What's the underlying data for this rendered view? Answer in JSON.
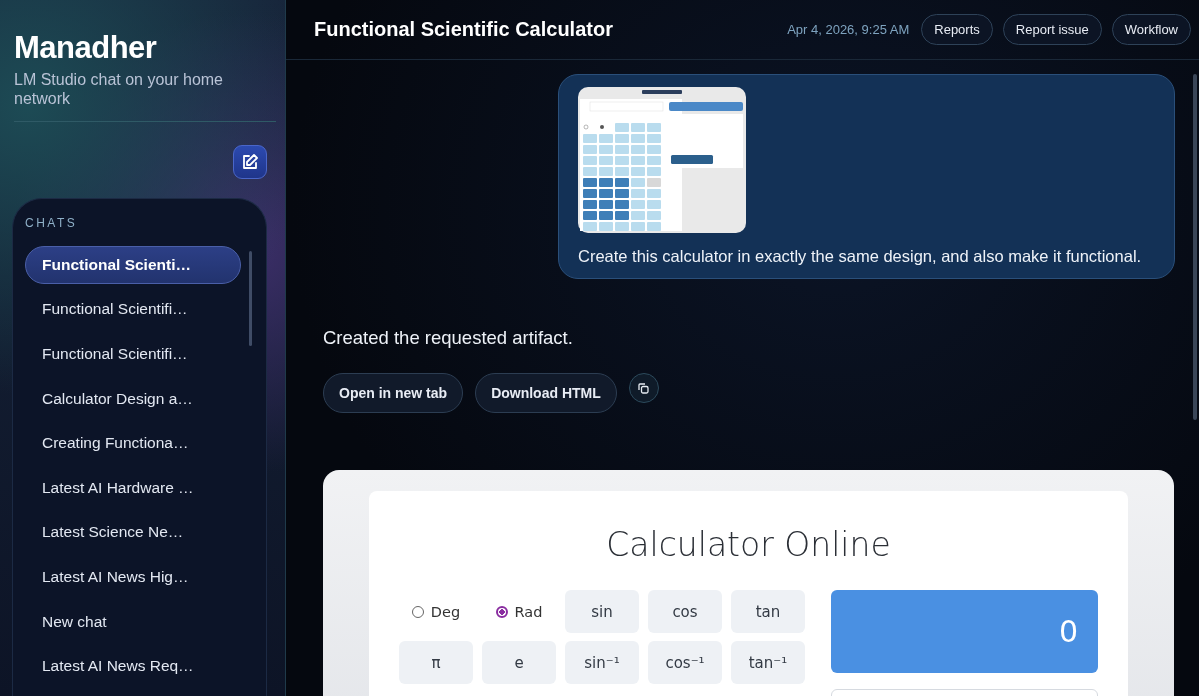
{
  "sidebar": {
    "title": "Manadher",
    "subtitle": "LM Studio chat on your home network",
    "section_label": "CHATS",
    "chats": [
      {
        "label": "Functional Scienti…",
        "selected": true
      },
      {
        "label": "Functional Scientifi…",
        "selected": false
      },
      {
        "label": "Functional Scientifi…",
        "selected": false
      },
      {
        "label": "Calculator Design a…",
        "selected": false
      },
      {
        "label": "Creating Functiona…",
        "selected": false
      },
      {
        "label": "Latest AI Hardware …",
        "selected": false
      },
      {
        "label": "Latest Science Ne…",
        "selected": false
      },
      {
        "label": "Latest AI News Hig…",
        "selected": false
      },
      {
        "label": "New chat",
        "selected": false
      },
      {
        "label": "Latest AI News Req…",
        "selected": false
      }
    ]
  },
  "header": {
    "title": "Functional Scientific Calculator",
    "timestamp": "Apr 4, 2026, 9:25 AM",
    "buttons": [
      "Reports",
      "Report issue",
      "Workflow"
    ]
  },
  "user_message": {
    "attachment": {
      "kind": "screenshot"
    },
    "text": "Create this calculator in exactly the same design, and also make it functional."
  },
  "assistant_message": {
    "text": "Created the requested artifact.",
    "buttons": [
      "Open in new tab",
      "Download HTML"
    ]
  },
  "artifact": {
    "title": "Calculator Online",
    "display": "0",
    "cells": [
      {
        "kind": "radio",
        "label": "Deg",
        "selected": false
      },
      {
        "kind": "radio",
        "label": "Rad",
        "selected": true
      },
      {
        "kind": "key",
        "label": "sin"
      },
      {
        "kind": "key",
        "label": "cos"
      },
      {
        "kind": "key",
        "label": "tan"
      },
      {
        "kind": "key",
        "label": "π"
      },
      {
        "kind": "key",
        "label": "e"
      },
      {
        "kind": "key",
        "label": "sin⁻¹"
      },
      {
        "kind": "key",
        "label": "cos⁻¹"
      },
      {
        "kind": "key",
        "label": "tan⁻¹"
      }
    ]
  }
}
